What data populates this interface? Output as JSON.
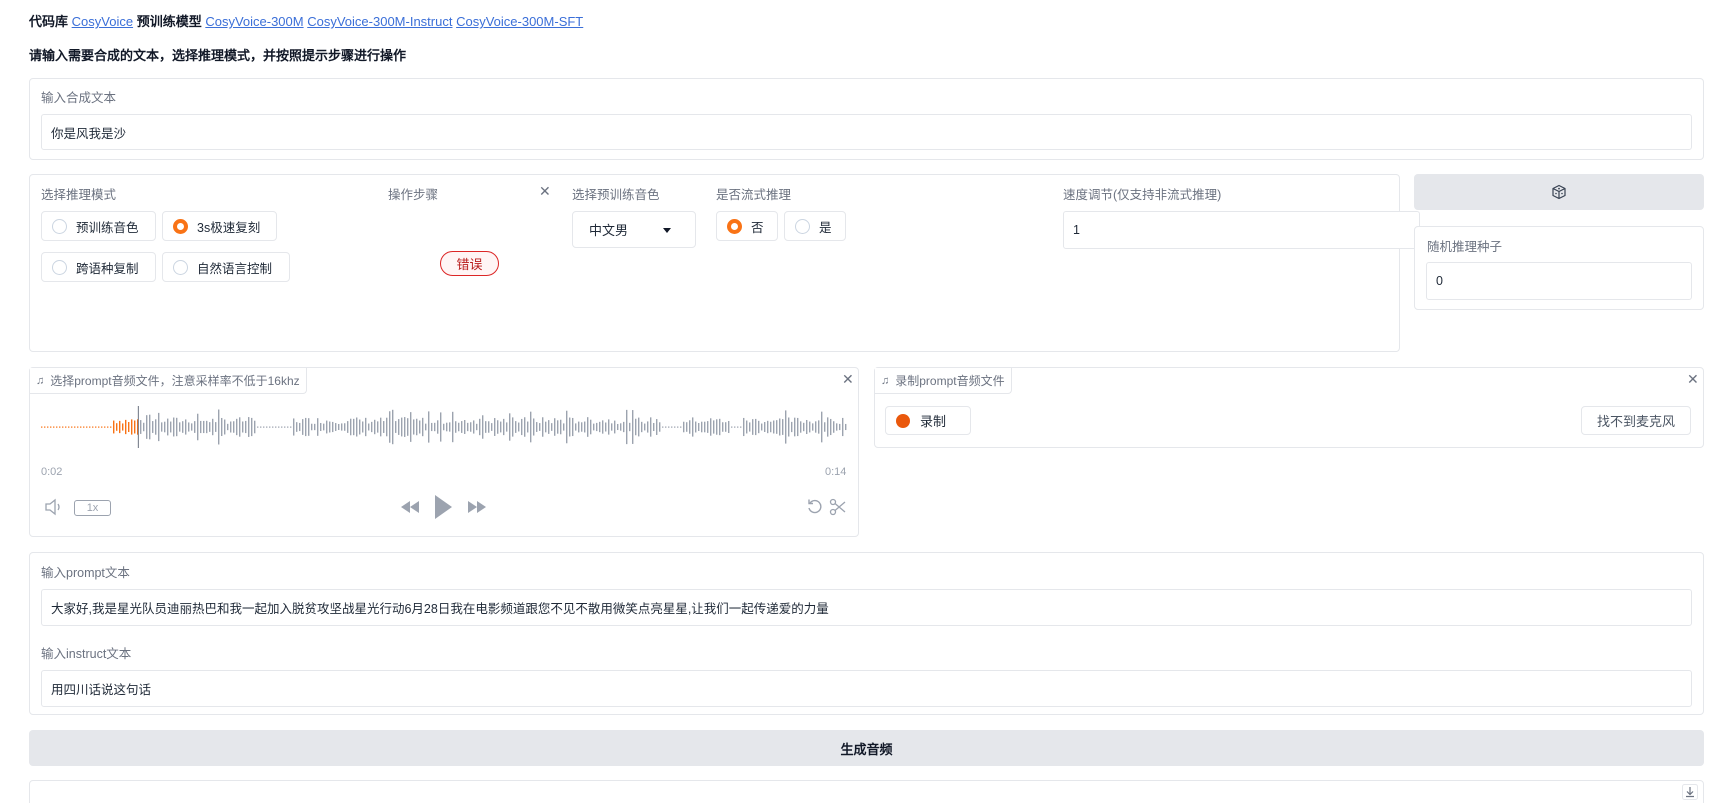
{
  "header": {
    "repo_label": "代码库",
    "repo_link": "CosyVoice",
    "models_label": "预训练模型",
    "models": [
      "CosyVoice-300M",
      "CosyVoice-300M-Instruct",
      "CosyVoice-300M-SFT"
    ]
  },
  "instruction": "请输入需要合成的文本，选择推理模式，并按照提示步骤进行操作",
  "tts_input": {
    "label": "输入合成文本",
    "value": "你是风我是沙"
  },
  "mode": {
    "label": "选择推理模式",
    "options": [
      "预训练音色",
      "3s极速复刻",
      "跨语种复制",
      "自然语言控制"
    ],
    "selected": "3s极速复刻"
  },
  "steps": {
    "label": "操作步骤",
    "status": "错误"
  },
  "voice": {
    "label": "选择预训练音色",
    "value": "中文男"
  },
  "stream": {
    "label": "是否流式推理",
    "options": [
      "否",
      "是"
    ],
    "selected": "否"
  },
  "speed": {
    "label": "速度调节(仅支持非流式推理)",
    "value": "1"
  },
  "seed": {
    "label": "随机推理种子",
    "value": "0",
    "button_icon": "dice-icon"
  },
  "prompt_audio": {
    "label": "选择prompt音频文件，注意采样率不低于16khz",
    "current_time": "0:02",
    "duration": "0:14",
    "playback_rate": "1x",
    "progress": 0.12
  },
  "record": {
    "label": "录制prompt音频文件",
    "record_label": "录制",
    "mic_label": "找不到麦克风"
  },
  "prompt_text": {
    "label": "输入prompt文本",
    "value": "大家好,我是星光队员迪丽热巴和我一起加入脱贫攻坚战星光行动6月28日我在电影频道跟您不见不散用微笑点亮星星,让我们一起传递爱的力量"
  },
  "instruct_text": {
    "label": "输入instruct文本",
    "value": "用四川话说这句话"
  },
  "generate": {
    "label": "生成音频"
  },
  "colors": {
    "accent": "#f97316",
    "link": "#3b6fd8",
    "error": "#dc2626"
  }
}
